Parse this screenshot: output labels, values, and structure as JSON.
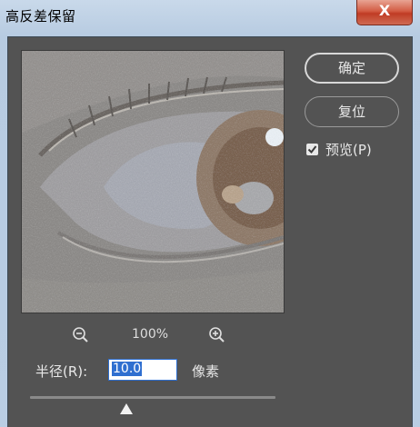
{
  "window": {
    "title": "高反差保留",
    "close_label": "X"
  },
  "buttons": {
    "ok": "确定",
    "reset": "复位"
  },
  "preview_option": {
    "label": "预览(P)",
    "checked": true
  },
  "zoom": {
    "level": "100%",
    "zoom_out_icon": "zoom-out-icon",
    "zoom_in_icon": "zoom-in-icon"
  },
  "radius": {
    "label": "半径(R):",
    "value": "10.0",
    "unit": "像素"
  },
  "slider": {
    "value": "10.0"
  },
  "colors": {
    "panel": "#535353",
    "accent": "#2f6fd0",
    "close": "#c8492f"
  }
}
